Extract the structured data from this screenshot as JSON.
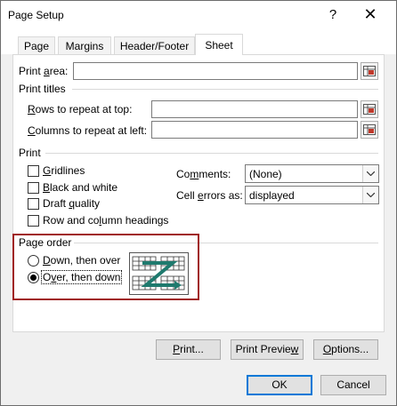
{
  "window": {
    "title": "Page Setup",
    "help_label": "?",
    "close_label": "✕"
  },
  "tabs": [
    {
      "label": "Page",
      "active": false
    },
    {
      "label": "Margins",
      "active": false
    },
    {
      "label": "Header/Footer",
      "active": false
    },
    {
      "label": "Sheet",
      "active": true
    }
  ],
  "print_area": {
    "label_pre": "Print ",
    "label_key": "a",
    "label_post": "rea:",
    "value": ""
  },
  "print_titles": {
    "heading": "Print titles",
    "rows_pre": "",
    "rows_key": "R",
    "rows_post": "ows to repeat at top:",
    "rows_value": "",
    "cols_pre": "",
    "cols_key": "C",
    "cols_post": "olumns to repeat at left:",
    "cols_value": ""
  },
  "print": {
    "heading": "Print",
    "gridlines": {
      "pre": "",
      "key": "G",
      "post": "ridlines",
      "checked": false
    },
    "black_white": {
      "pre": "",
      "key": "B",
      "post": "lack and white",
      "checked": false
    },
    "draft_quality": {
      "pre": "Draft ",
      "key": "q",
      "post": "uality",
      "checked": false
    },
    "row_col_headings": {
      "pre": "Row and co",
      "key": "l",
      "post": "umn headings",
      "checked": false
    },
    "comments": {
      "pre": "Co",
      "key": "m",
      "post": "ments:",
      "value": "(None)"
    },
    "cell_errors": {
      "pre": "Cell ",
      "key": "e",
      "post": "rrors as:",
      "value": "displayed"
    }
  },
  "page_order": {
    "heading": "Page order",
    "down_over": {
      "pre": "",
      "key": "D",
      "post": "own, then over",
      "selected": false
    },
    "over_down": {
      "pre": "O",
      "key": "v",
      "post": "er, then down",
      "selected": true
    }
  },
  "buttons": {
    "print": {
      "pre": "",
      "key": "P",
      "post": "rint..."
    },
    "preview": {
      "pre": "Print Previe",
      "key": "w",
      "post": ""
    },
    "options": {
      "pre": "",
      "key": "O",
      "post": "ptions..."
    },
    "ok": "OK",
    "cancel": "Cancel"
  },
  "colors": {
    "highlight_border": "#a01f1f",
    "icon_teal": "#1f7a6e",
    "default_button_border": "#0078d7"
  }
}
